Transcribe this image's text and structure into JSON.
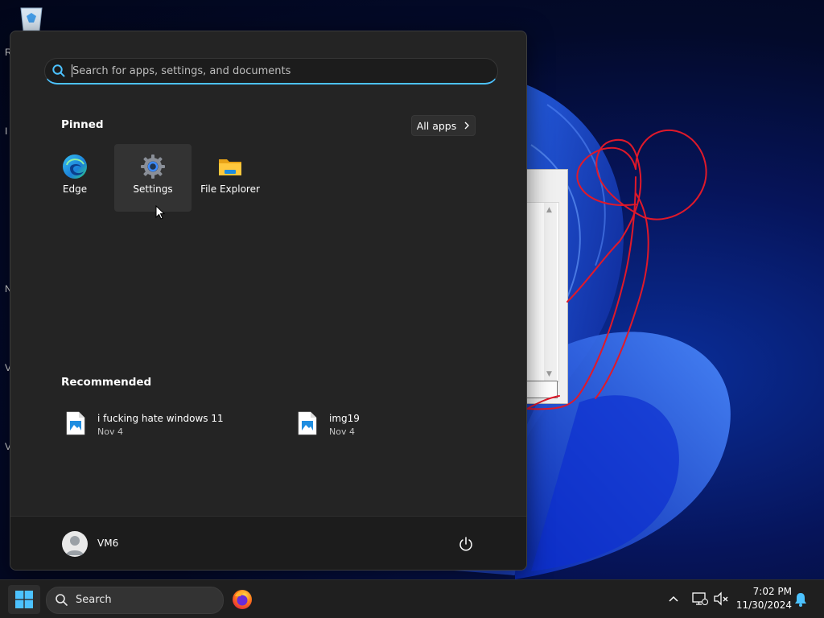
{
  "desktop": {
    "letters": [
      "R",
      "I",
      "N",
      "V",
      "V"
    ]
  },
  "start_menu": {
    "search": {
      "placeholder": "Search for apps, settings, and documents",
      "value": ""
    },
    "pinned": {
      "title": "Pinned",
      "all_apps_label": "All apps",
      "apps": [
        {
          "label": "Edge",
          "icon": "edge-icon"
        },
        {
          "label": "Settings",
          "icon": "gear-icon"
        },
        {
          "label": "File Explorer",
          "icon": "folder-icon"
        }
      ]
    },
    "recommended": {
      "title": "Recommended",
      "items": [
        {
          "name": "i fucking hate windows 11",
          "date": "Nov 4",
          "icon": "image-file-icon"
        },
        {
          "name": "img19",
          "date": "Nov 4",
          "icon": "image-file-icon"
        }
      ]
    },
    "footer": {
      "user_name": "VM6",
      "power_icon": "power-icon"
    }
  },
  "taskbar": {
    "search_label": "Search",
    "clock": {
      "time": "7:02 PM",
      "date": "11/30/2024"
    }
  },
  "colors": {
    "menu_bg": "#242424",
    "accent": "#4cc2ff",
    "scribble": "#e0192a"
  }
}
